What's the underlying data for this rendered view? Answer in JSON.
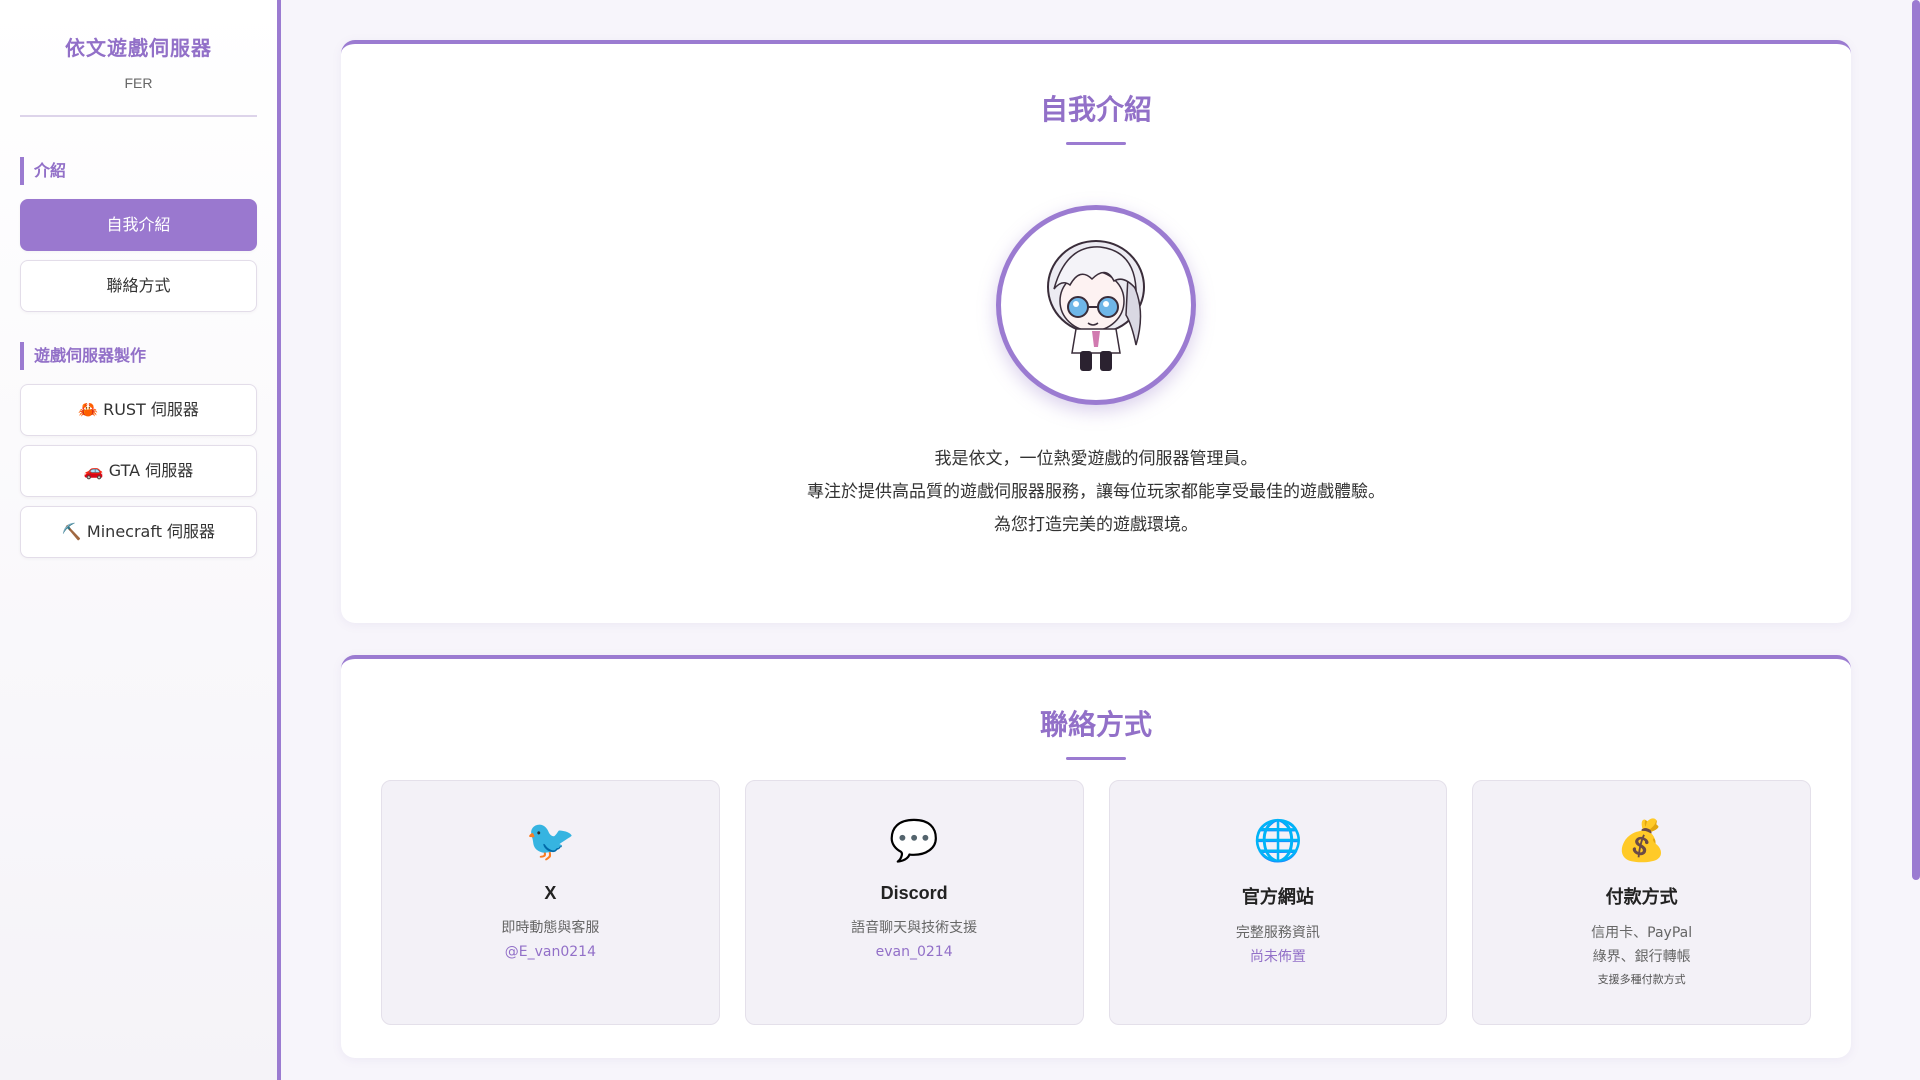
{
  "sidebar": {
    "brand_title": "依文遊戲伺服器",
    "brand_sub": "FER",
    "sections": [
      {
        "label": "介紹",
        "items": [
          "自我介紹",
          "聯絡方式"
        ]
      },
      {
        "label": "遊戲伺服器製作",
        "items": [
          "🦀 RUST 伺服器",
          "🚗 GTA 伺服器",
          "⛏️ Minecraft 伺服器"
        ]
      }
    ],
    "active_item": "自我介紹"
  },
  "intro_card": {
    "title": "自我介紹",
    "lines": [
      "我是依文，一位熱愛遊戲的伺服器管理員。",
      "專注於提供高品質的遊戲伺服器服務，讓每位玩家都能享受最佳的遊戲體驗。",
      "為您打造完美的遊戲環境。"
    ]
  },
  "contact_card": {
    "title": "聯絡方式",
    "items": [
      {
        "icon": "🐦",
        "icon_name": "bird-icon",
        "name": "X",
        "desc": "即時動態與客服",
        "link": "@E_van0214"
      },
      {
        "icon": "💬",
        "icon_name": "speech-bubble-icon",
        "name": "Discord",
        "desc": "語音聊天與技術支援",
        "link": "evan_0214"
      },
      {
        "icon": "🌐",
        "icon_name": "globe-icon",
        "name": "官方網站",
        "desc": "完整服務資訊",
        "link": "尚未佈置"
      },
      {
        "icon": "💰",
        "icon_name": "money-bag-icon",
        "name": "付款方式",
        "desc": "信用卡、PayPal",
        "desc2": "綠界、銀行轉帳",
        "note": "支援多種付款方式"
      }
    ]
  },
  "colors": {
    "accent": "#9b7bd1",
    "accent_text": "#9270c8"
  }
}
